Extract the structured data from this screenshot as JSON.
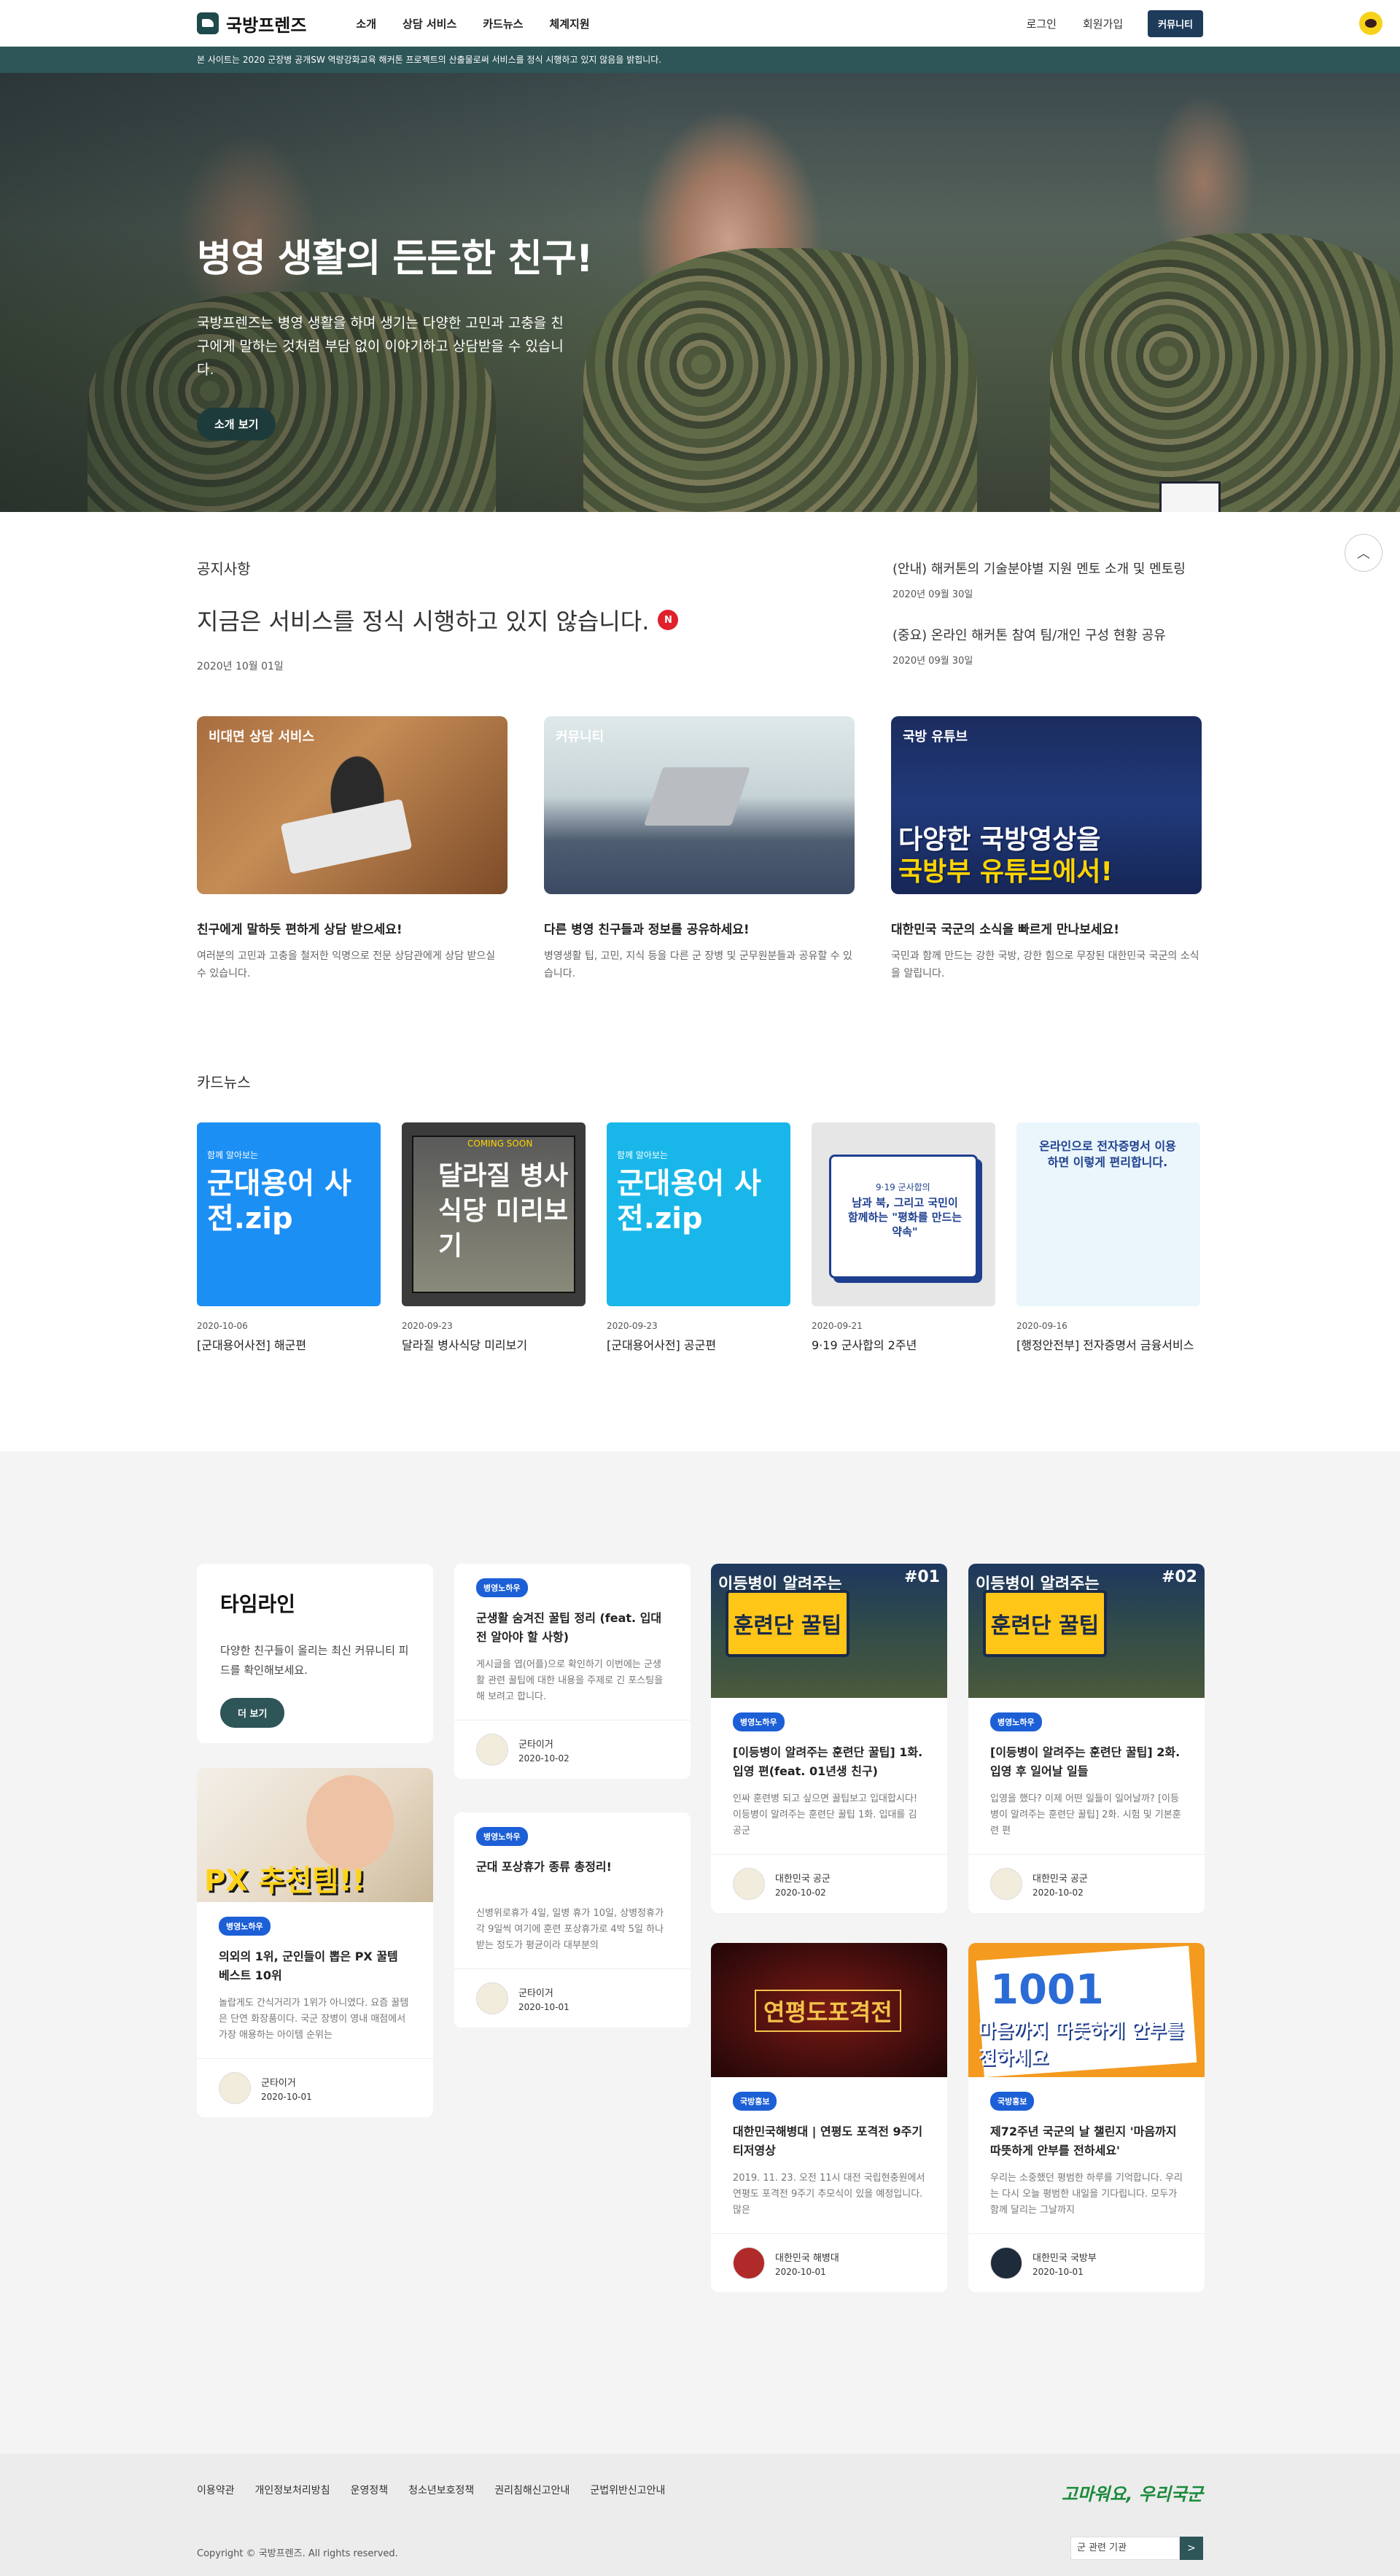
{
  "header": {
    "logo": "국방프렌즈",
    "nav": [
      "소개",
      "상담 서비스",
      "카드뉴스",
      "체계지원"
    ],
    "login": "로그인",
    "signup": "회원가입",
    "community": "커뮤니티"
  },
  "topbar": {
    "text": "본 사이트는 2020 군장병 공개SW 역량강화교육 해커톤 프로젝트의 산출물로써 서비스를 정식 시행하고 있지 않음을 밝힙니다."
  },
  "hero": {
    "title": "병영 생활의 든든한 친구!",
    "desc": "국방프렌즈는 병영 생활을 하며 생기는 다양한 고민과 고충을 친구에게 말하는 것처럼 부담 없이 이야기하고 상담받을 수 있습니다.",
    "button": "소개 보기"
  },
  "notice": {
    "label": "공지사항",
    "main_title": "지금은 서비스를 정식 시행하고 있지 않습니다.",
    "badge": "N",
    "main_date": "2020년 10월 01일",
    "items": [
      {
        "title": "(안내) 해커톤의 기술분야별 지원 멘토 소개 및 멘토링",
        "date": "2020년 09월 30일"
      },
      {
        "title": "(중요) 온라인 해커톤 참여 팀/개인 구성 현황 공유",
        "date": "2020년 09월 30일"
      }
    ]
  },
  "services": [
    {
      "tag": "비대면 상담 서비스",
      "title": "친구에게 말하듯 편하게 상담 받으세요!",
      "desc": "여러분의 고민과 고충을 철저한 익명으로 전문 상담관에게 상담 받으실 수 있습니다."
    },
    {
      "tag": "커뮤니티",
      "title": "다른 병영 친구들과 정보를 공유하세요!",
      "desc": "병영생활 팁, 고민, 지식 등을 다른 군 장병 및 군무원분들과 공유할 수 있습니다."
    },
    {
      "tag": "국방 유튜브",
      "title": "대한민국 국군의 소식을 빠르게 만나보세요!",
      "desc": "국민과 함께 만드는 강한 국방, 강한 힘으로 무장된 대한민국 국군의 소식을 알립니다.",
      "image_text": [
        "다양한 국방영상을",
        "국방부 유튜브에서!"
      ]
    }
  ],
  "cardnews": {
    "label": "카드뉴스",
    "items": [
      {
        "img_sub": "함께 알아보는",
        "img_text": "군대용어 사전.zip",
        "date": "2020-10-06",
        "title": "[군대용어사전] 해군편"
      },
      {
        "img_sub": "COMING SOON",
        "img_text": "달라질 병사식당 미리보기",
        "date": "2020-09-23",
        "title": "달라질 병사식당 미리보기"
      },
      {
        "img_sub": "함께 알아보는",
        "img_text": "군대용어 사전.zip",
        "date": "2020-09-23",
        "title": "[군대용어사전] 공군편"
      },
      {
        "img_sub": "9·19 군사합의",
        "img_text": "남과 북, 그리고 국민이 함께하는 \"평화를 만드는 약속\"",
        "date": "2020-09-21",
        "title": "9·19 군사합의 2주년"
      },
      {
        "img_sub": "",
        "img_text": "온라인으로 전자증명서 이용하면 이렇게 편리합니다.",
        "date": "2020-09-16",
        "title": "[행정안전부] 전자증명서 금융서비스"
      }
    ]
  },
  "timeline": {
    "title": "타임라인",
    "desc": "다양한 친구들이 올리는 최신 커뮤니티 피드를 확인해보세요.",
    "button": "더 보기",
    "cards": [
      {
        "tag": "병영노하우",
        "title": "군생활 숨겨진 꿀팁 정리 (feat. 입대 전 알아야 할 사항)",
        "text": "게시글을 엽(어플)으로 확인하기 이번에는 군생활 관련 꿀팁에 대한 내용을 주제로 긴 포스팅을 해 보려고 합니다.",
        "author": "군타이거",
        "date": "2020-10-02"
      },
      {
        "tag": "병영노하우",
        "title": "군대 포상휴가 종류 총정리!",
        "text": "신병위로휴가 4일, 일병 휴가 10일, 상병정휴가 각 9일씩 여기에 훈련 포상휴가로 4박 5일 하나 받는 정도가 평균이라 대부분의",
        "author": "군타이거",
        "date": "2020-10-01"
      },
      {
        "tag": "병영노하우",
        "title": "의외의 1위, 군인들이 뽑은 PX 꿀템 베스트 10위",
        "text": "놀랍게도 간식거리가 1위가 아니였다. 요즘 꿀템은 단연 화장품이다. 국군 장병이 영내 매점에서 가장 애용하는 아이템 순위는",
        "author": "군타이거",
        "date": "2020-10-01",
        "img_text": "PX 추천템!!"
      },
      {
        "tag": "병영노하우",
        "title": "[이등병이 알려주는 훈련단 꿀팁] 1화. 입영 편(feat. 01년생 친구)",
        "text": "인싸 훈련병 되고 싶으면 꿀팁보고 입대합시다! 이등병이 알려주는 훈련단 꿀팁 1화. 입대를 김공군",
        "author": "대한민국 공군",
        "date": "2020-10-02",
        "img_top": "이등병이 알려주는",
        "img_text": "훈련단 꿀팁",
        "img_num": "#01"
      },
      {
        "tag": "병영노하우",
        "title": "[이등병이 알려주는 훈련단 꿀팁] 2화. 입영 후 일어날 일들",
        "text": "입영을 했다? 이제 어떤 일들이 일어날까? [이등병이 알려주는 훈련단 꿀팁] 2화. 시험 및 기본훈련 편",
        "author": "대한민국 공군",
        "date": "2020-10-02",
        "img_top": "이등병이 알려주는",
        "img_text": "훈련단 꿀팁",
        "img_num": "#02"
      },
      {
        "tag": "국방홍보",
        "title": "대한민국해병대 | 연평도 포격전 9주기 티저영상",
        "text": "2019. 11. 23. 오전 11시 대전 국립현충원에서 연평도 포격전 9주기 추모식이 있을 예정입니다. 많은",
        "author": "대한민국 해병대",
        "date": "2020-10-01",
        "img_text": "연평도포격전"
      },
      {
        "tag": "국방홍보",
        "title": "제72주년 국군의 날 챌린지 '마음까지 따뜻하게 안부를 전하세요'",
        "text": "우리는 소중했던 평범한 하루를 기억합니다. 우리는 다시 오늘 평범한 내일을 기다립니다. 모두가 함께 달리는 그날까지",
        "author": "대한민국 국방부",
        "date": "2020-10-01",
        "img_text": "1001",
        "img_text2": "마음까지 따뜻하게 안부를 전하세요"
      }
    ]
  },
  "footer": {
    "links": [
      "이용약관",
      "개인정보처리방침",
      "운영정책",
      "청소년보호정책",
      "권리침해신고안내",
      "군법위반신고안내"
    ],
    "copyright": "Copyright © 국방프렌즈. All rights reserved.",
    "brand": "고마워요, 우리국군",
    "select": "군 관련 기관",
    "go": ">"
  }
}
